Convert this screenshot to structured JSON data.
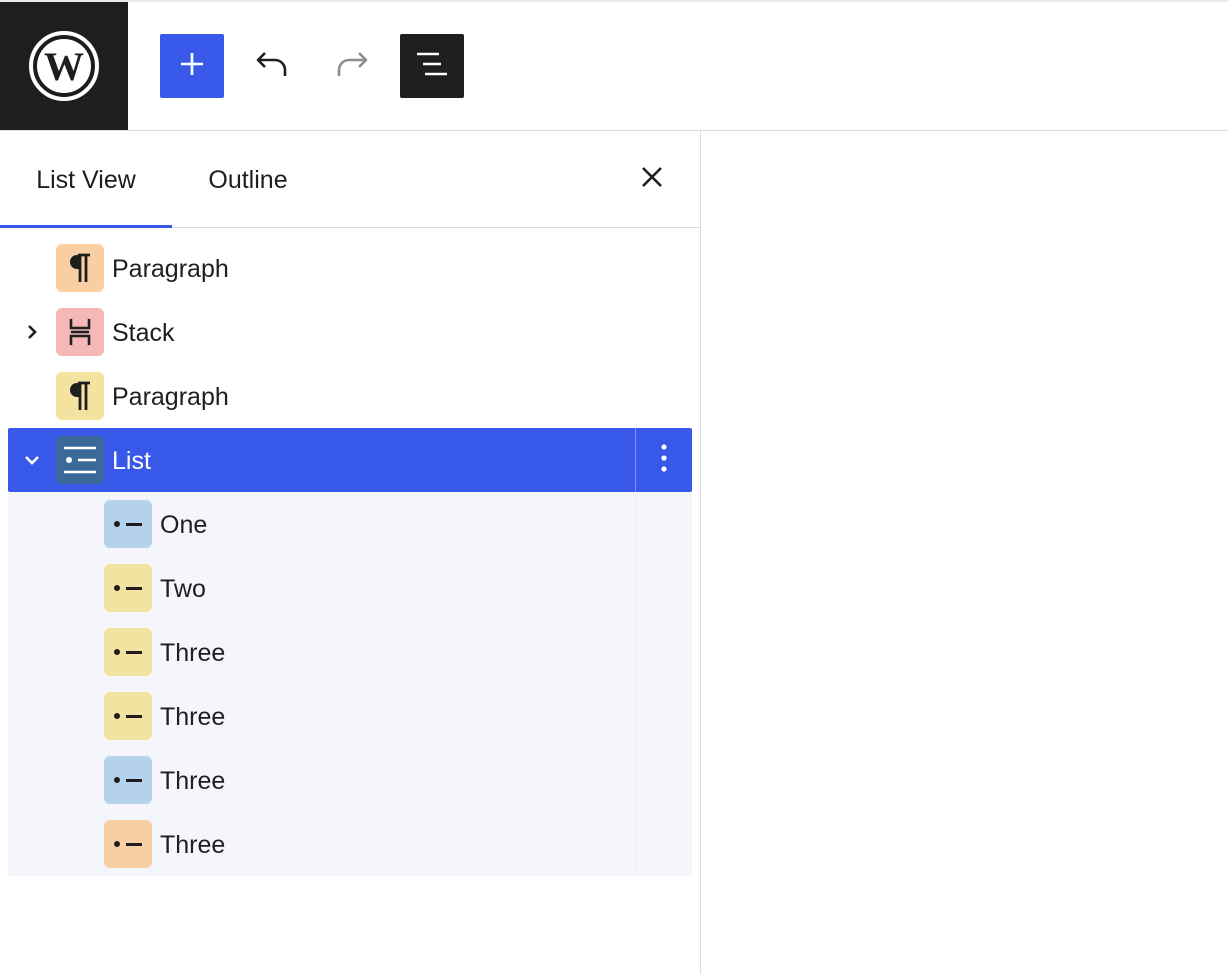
{
  "toolbar": {
    "logo_icon": "wordpress-logo-icon",
    "add_icon": "plus-icon",
    "undo_icon": "undo-icon",
    "redo_icon": "redo-icon",
    "list_view_icon": "list-view-icon"
  },
  "panel": {
    "tabs": [
      {
        "label": "List View",
        "active": true
      },
      {
        "label": "Outline",
        "active": false
      }
    ],
    "close_icon": "close-icon"
  },
  "tree": {
    "items": [
      {
        "label": "Paragraph",
        "icon": "paragraph-icon",
        "icon_bg": "#f7cfa3"
      },
      {
        "label": "Stack",
        "icon": "stack-icon",
        "icon_bg": "#f5b8b8",
        "chevron": "chevron-right-icon"
      },
      {
        "label": "Paragraph",
        "icon": "paragraph-icon",
        "icon_bg": "#f4e3a0"
      },
      {
        "label": "List",
        "icon": "list-icon",
        "icon_bg": "#3b6a9a",
        "chevron": "chevron-down-icon",
        "selected": true,
        "options_icon": "more-vertical-icon"
      }
    ],
    "children": [
      {
        "label": "One",
        "icon": "list-item-icon",
        "icon_bg": "#b4d2ec"
      },
      {
        "label": "Two",
        "icon": "list-item-icon",
        "icon_bg": "#f4e3a0"
      },
      {
        "label": "Three",
        "icon": "list-item-icon",
        "icon_bg": "#f4e3a0"
      },
      {
        "label": "Three",
        "icon": "list-item-icon",
        "icon_bg": "#f4e3a0"
      },
      {
        "label": "Three",
        "icon": "list-item-icon",
        "icon_bg": "#b4d2ec"
      },
      {
        "label": "Three",
        "icon": "list-item-icon",
        "icon_bg": "#f7cfa3"
      }
    ]
  },
  "colors": {
    "accent": "#3858e9",
    "dark": "#1e1e1e",
    "child_row_bg": "#f5f6fc"
  }
}
